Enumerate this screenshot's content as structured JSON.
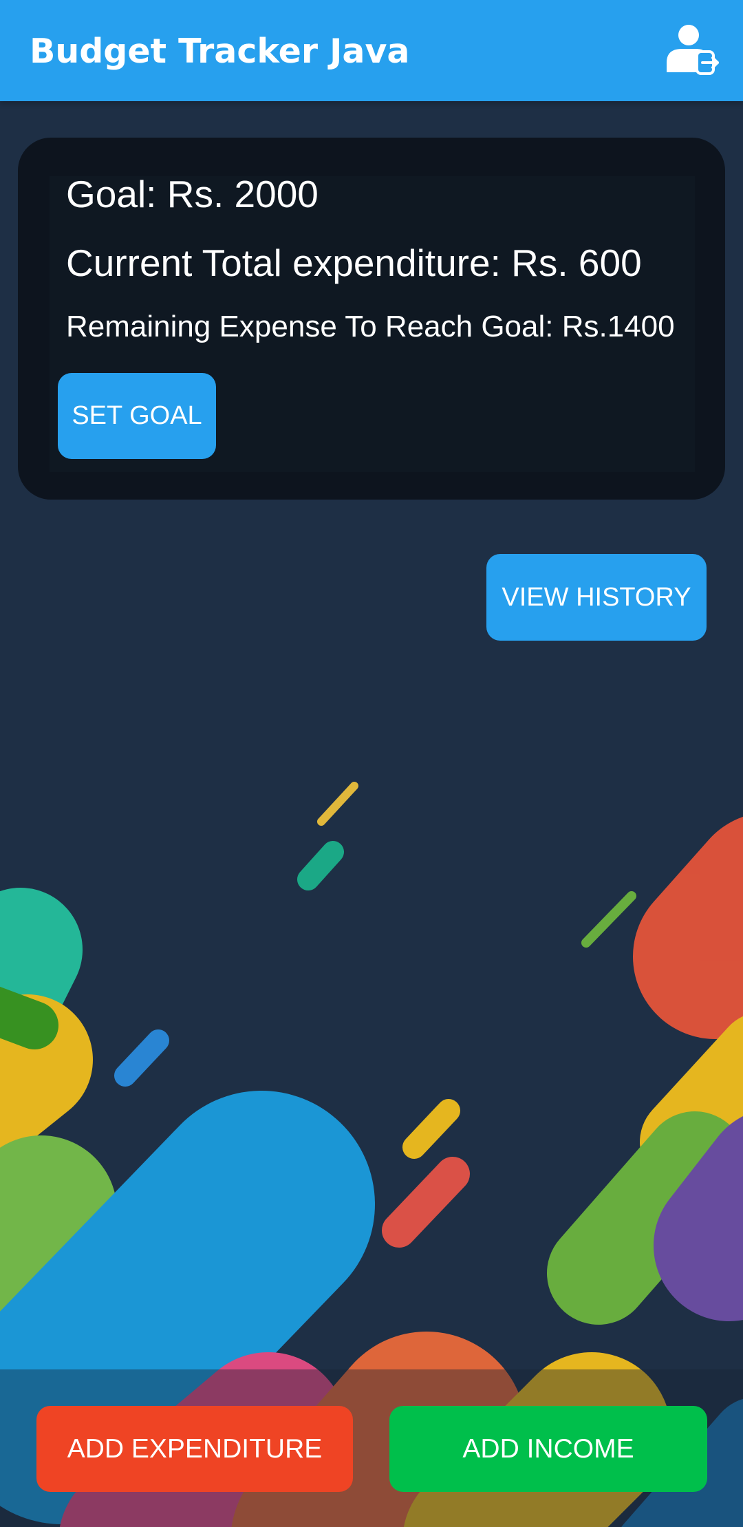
{
  "app_bar": {
    "title": "Budget Tracker Java",
    "logout_icon": "person-logout-icon"
  },
  "goal_card": {
    "goal_text": "Goal: Rs. 2000",
    "current_total_text": "Current Total expenditure: Rs. 600",
    "remaining_text": "Remaining Expense To Reach Goal: Rs.1400",
    "set_goal_label": "SET GOAL"
  },
  "actions": {
    "view_history_label": "VIEW HISTORY",
    "add_expenditure_label": "ADD EXPENDITURE",
    "add_income_label": "ADD INCOME"
  },
  "colors": {
    "primary": "#27a0ee",
    "background": "#1e2f45",
    "card": "#0d141e",
    "expenditure": "#ef4424",
    "income": "#00bf4b"
  }
}
